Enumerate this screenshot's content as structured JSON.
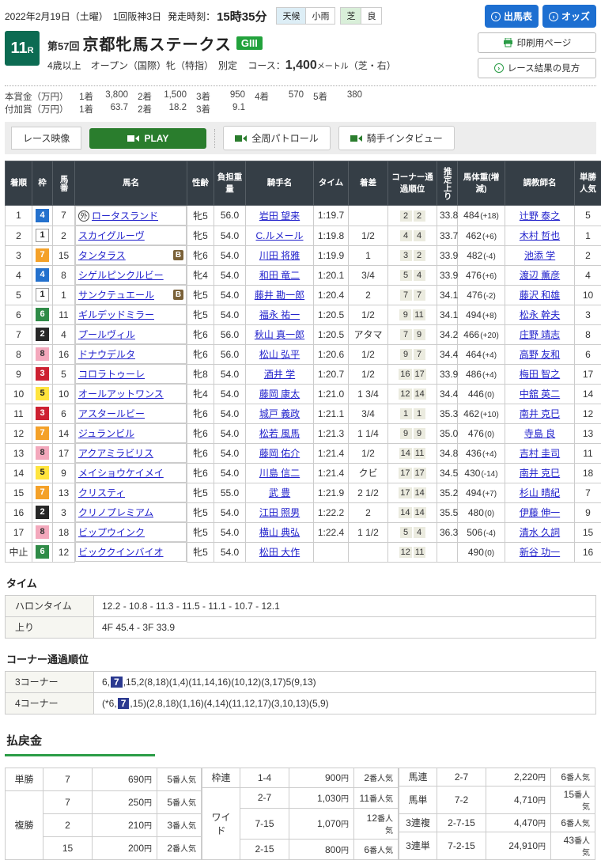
{
  "page": {
    "date_line": "2022年2月19日（土曜）　1回阪神3日",
    "start_label": "発走時刻：",
    "start_time": "15時35分",
    "weather_label": "天候",
    "weather_value": "小雨",
    "turf_label": "芝",
    "turf_value": "良",
    "buttons": {
      "entries": "出馬表",
      "odds": "オッズ",
      "print": "印刷用ページ",
      "guide": "レース結果の見方",
      "arrow_glyph": "›"
    }
  },
  "race": {
    "number": "11",
    "number_suffix": "R",
    "edition": "第57回",
    "title": "京都牝馬ステークス",
    "grade": "GIII",
    "conditions": "4歳以上　オープン（国際）牝（特指）　別定",
    "course_label": "コース：",
    "distance": "1,400",
    "distance_unit": "メートル",
    "course_note": "（芝・右）"
  },
  "prizes": {
    "main_label": "本賞金（万円）",
    "main": [
      {
        "rank": "1着",
        "amount": "3,800"
      },
      {
        "rank": "2着",
        "amount": "1,500"
      },
      {
        "rank": "3着",
        "amount": "950"
      },
      {
        "rank": "4着",
        "amount": "570"
      },
      {
        "rank": "5着",
        "amount": "380"
      }
    ],
    "additional_label": "付加賞（万円）",
    "additional": [
      {
        "rank": "1着",
        "amount": "63.7"
      },
      {
        "rank": "2着",
        "amount": "18.2"
      },
      {
        "rank": "3着",
        "amount": "9.1"
      }
    ]
  },
  "video": {
    "label": "レース映像",
    "play": "PLAY",
    "patrol": "全周パトロール",
    "interview": "騎手インタビュー"
  },
  "results": {
    "headers": {
      "pos": "着順",
      "waku": "枠",
      "num": "馬番",
      "name": "馬名",
      "sexage": "性齢",
      "weight": "負担重量",
      "jockey": "騎手名",
      "time": "タイム",
      "margin": "着差",
      "corner": "コーナー通過順位",
      "last3f": "推定上り",
      "hweight": "馬体重(増減)",
      "trainer": "調教師名",
      "pop": "単勝人気"
    },
    "rows": [
      {
        "pos": "1",
        "waku": "4",
        "num": "7",
        "mark": "外",
        "b": false,
        "name": "ロータスランド",
        "sexage": "牝5",
        "weight": "56.0",
        "jockey": "岩田 望来",
        "time": "1:19.7",
        "margin": "",
        "corner": [
          "2",
          "2"
        ],
        "last3f": "33.8",
        "hw": "484",
        "hwd": "(+18)",
        "trainer": "辻野 泰之",
        "pop": "5"
      },
      {
        "pos": "2",
        "waku": "1",
        "num": "2",
        "mark": "",
        "b": false,
        "name": "スカイグルーヴ",
        "sexage": "牝5",
        "weight": "54.0",
        "jockey": "C.ルメール",
        "time": "1:19.8",
        "margin": "1/2",
        "corner": [
          "4",
          "4"
        ],
        "last3f": "33.7",
        "hw": "462",
        "hwd": "(+6)",
        "trainer": "木村 哲也",
        "pop": "1"
      },
      {
        "pos": "3",
        "waku": "7",
        "num": "15",
        "mark": "",
        "b": true,
        "name": "タンタラス",
        "sexage": "牝6",
        "weight": "54.0",
        "jockey": "川田 将雅",
        "time": "1:19.9",
        "margin": "1",
        "corner": [
          "3",
          "2"
        ],
        "last3f": "33.9",
        "hw": "482",
        "hwd": "(-4)",
        "trainer": "池添 学",
        "pop": "2"
      },
      {
        "pos": "4",
        "waku": "4",
        "num": "8",
        "mark": "",
        "b": false,
        "name": "シゲルピンクルビー",
        "sexage": "牝4",
        "weight": "54.0",
        "jockey": "和田 竜二",
        "time": "1:20.1",
        "margin": "3/4",
        "corner": [
          "5",
          "4"
        ],
        "last3f": "33.9",
        "hw": "476",
        "hwd": "(+6)",
        "trainer": "渡辺 薫彦",
        "pop": "4"
      },
      {
        "pos": "5",
        "waku": "1",
        "num": "1",
        "mark": "",
        "b": true,
        "name": "サンクテュエール",
        "sexage": "牝5",
        "weight": "54.0",
        "jockey": "藤井 勘一郎",
        "time": "1:20.4",
        "margin": "2",
        "corner": [
          "7",
          "7"
        ],
        "last3f": "34.1",
        "hw": "476",
        "hwd": "(-2)",
        "trainer": "藤沢 和雄",
        "pop": "10"
      },
      {
        "pos": "6",
        "waku": "6",
        "num": "11",
        "mark": "",
        "b": false,
        "name": "ギルデッドミラー",
        "sexage": "牝5",
        "weight": "54.0",
        "jockey": "福永 祐一",
        "time": "1:20.5",
        "margin": "1/2",
        "corner": [
          "9",
          "11"
        ],
        "last3f": "34.1",
        "hw": "494",
        "hwd": "(+8)",
        "trainer": "松永 幹夫",
        "pop": "3"
      },
      {
        "pos": "7",
        "waku": "2",
        "num": "4",
        "mark": "",
        "b": false,
        "name": "プールヴィル",
        "sexage": "牝6",
        "weight": "56.0",
        "jockey": "秋山 真一郎",
        "time": "1:20.5",
        "margin": "アタマ",
        "corner": [
          "7",
          "9"
        ],
        "last3f": "34.2",
        "hw": "466",
        "hwd": "(+20)",
        "trainer": "庄野 靖志",
        "pop": "8"
      },
      {
        "pos": "8",
        "waku": "8",
        "num": "16",
        "mark": "",
        "b": false,
        "name": "ドナウデルタ",
        "sexage": "牝6",
        "weight": "56.0",
        "jockey": "松山 弘平",
        "time": "1:20.6",
        "margin": "1/2",
        "corner": [
          "9",
          "7"
        ],
        "last3f": "34.4",
        "hw": "464",
        "hwd": "(+4)",
        "trainer": "高野 友和",
        "pop": "6"
      },
      {
        "pos": "9",
        "waku": "3",
        "num": "5",
        "mark": "",
        "b": false,
        "name": "コロラトゥーレ",
        "sexage": "牝8",
        "weight": "54.0",
        "jockey": "酒井 学",
        "time": "1:20.7",
        "margin": "1/2",
        "corner": [
          "16",
          "17"
        ],
        "last3f": "33.9",
        "hw": "486",
        "hwd": "(+4)",
        "trainer": "梅田 智之",
        "pop": "17"
      },
      {
        "pos": "10",
        "waku": "5",
        "num": "10",
        "mark": "",
        "b": false,
        "name": "オールアットワンス",
        "sexage": "牝4",
        "weight": "54.0",
        "jockey": "藤岡 康太",
        "time": "1:21.0",
        "margin": "1 3/4",
        "corner": [
          "12",
          "14"
        ],
        "last3f": "34.4",
        "hw": "446",
        "hwd": "(0)",
        "trainer": "中舘 英二",
        "pop": "14"
      },
      {
        "pos": "11",
        "waku": "3",
        "num": "6",
        "mark": "",
        "b": false,
        "name": "アスタールビー",
        "sexage": "牝6",
        "weight": "54.0",
        "jockey": "城戸 義政",
        "time": "1:21.1",
        "margin": "3/4",
        "corner": [
          "1",
          "1"
        ],
        "last3f": "35.3",
        "hw": "462",
        "hwd": "(+10)",
        "trainer": "南井 克巳",
        "pop": "12"
      },
      {
        "pos": "12",
        "waku": "7",
        "num": "14",
        "mark": "",
        "b": false,
        "name": "ジュランビル",
        "sexage": "牝6",
        "weight": "54.0",
        "jockey": "松若 風馬",
        "time": "1:21.3",
        "margin": "1 1/4",
        "corner": [
          "9",
          "9"
        ],
        "last3f": "35.0",
        "hw": "476",
        "hwd": "(0)",
        "trainer": "寺島 良",
        "pop": "13"
      },
      {
        "pos": "13",
        "waku": "8",
        "num": "17",
        "mark": "",
        "b": false,
        "name": "アクアミラビリス",
        "sexage": "牝6",
        "weight": "54.0",
        "jockey": "藤岡 佑介",
        "time": "1:21.4",
        "margin": "1/2",
        "corner": [
          "14",
          "11"
        ],
        "last3f": "34.8",
        "hw": "436",
        "hwd": "(+4)",
        "trainer": "吉村 圭司",
        "pop": "11"
      },
      {
        "pos": "14",
        "waku": "5",
        "num": "9",
        "mark": "",
        "b": false,
        "name": "メイショウケイメイ",
        "sexage": "牝6",
        "weight": "54.0",
        "jockey": "川島 信二",
        "time": "1:21.4",
        "margin": "クビ",
        "corner": [
          "17",
          "17"
        ],
        "last3f": "34.5",
        "hw": "430",
        "hwd": "(-14)",
        "trainer": "南井 克巳",
        "pop": "18"
      },
      {
        "pos": "15",
        "waku": "7",
        "num": "13",
        "mark": "",
        "b": false,
        "name": "クリスティ",
        "sexage": "牝5",
        "weight": "55.0",
        "jockey": "武 豊",
        "time": "1:21.9",
        "margin": "2 1/2",
        "corner": [
          "17",
          "14"
        ],
        "last3f": "35.2",
        "hw": "494",
        "hwd": "(+7)",
        "trainer": "杉山 晴紀",
        "pop": "7"
      },
      {
        "pos": "16",
        "waku": "2",
        "num": "3",
        "mark": "",
        "b": false,
        "name": "クリノプレミアム",
        "sexage": "牝5",
        "weight": "54.0",
        "jockey": "江田 照男",
        "time": "1:22.2",
        "margin": "2",
        "corner": [
          "14",
          "14"
        ],
        "last3f": "35.5",
        "hw": "480",
        "hwd": "(0)",
        "trainer": "伊藤 伸一",
        "pop": "9"
      },
      {
        "pos": "17",
        "waku": "8",
        "num": "18",
        "mark": "",
        "b": false,
        "name": "ビップウインク",
        "sexage": "牝5",
        "weight": "54.0",
        "jockey": "横山 典弘",
        "time": "1:22.4",
        "margin": "1 1/2",
        "corner": [
          "5",
          "4"
        ],
        "last3f": "36.3",
        "hw": "506",
        "hwd": "(-4)",
        "trainer": "清水 久詞",
        "pop": "15"
      },
      {
        "pos": "中止",
        "waku": "6",
        "num": "12",
        "mark": "",
        "b": false,
        "name": "ビッククインバイオ",
        "sexage": "牝5",
        "weight": "54.0",
        "jockey": "松田 大作",
        "time": "",
        "margin": "",
        "corner": [
          "12",
          "11"
        ],
        "last3f": "",
        "hw": "490",
        "hwd": "(0)",
        "trainer": "新谷 功一",
        "pop": "16"
      }
    ]
  },
  "time_section": {
    "heading": "タイム",
    "rows": [
      {
        "label": "ハロンタイム",
        "value": "12.2 - 10.8 - 11.3 - 11.5 - 11.1 - 10.7 - 12.1"
      },
      {
        "label": "上り",
        "value": "4F 45.4 - 3F 33.9"
      }
    ]
  },
  "corner_section": {
    "heading": "コーナー通過順位",
    "rows": [
      {
        "label": "3コーナー",
        "pre": "6,",
        "mark": "7",
        "post": ",15,2(8,18)(1,4)(11,14,16)(10,12)(3,17)5(9,13)"
      },
      {
        "label": "4コーナー",
        "pre": "(*6,",
        "mark": "7",
        "post": ",15)(2,8,18)(1,16)(4,14)(11,12,17)(3,10,13)(5,9)"
      }
    ]
  },
  "payout": {
    "heading": "払戻金",
    "yen_suffix": "円",
    "pop_suffix": "番人気",
    "groups": [
      {
        "rows": [
          {
            "type": "単勝",
            "span": 1,
            "cells": [
              {
                "combo": "7",
                "amount": "690",
                "pop": "5"
              }
            ]
          },
          {
            "type": "複勝",
            "span": 3,
            "cells": [
              {
                "combo": "7",
                "amount": "250",
                "pop": "5"
              },
              {
                "combo": "2",
                "amount": "210",
                "pop": "3"
              },
              {
                "combo": "15",
                "amount": "200",
                "pop": "2"
              }
            ]
          }
        ]
      },
      {
        "rows": [
          {
            "type": "枠連",
            "span": 1,
            "cells": [
              {
                "combo": "1-4",
                "amount": "900",
                "pop": "2"
              }
            ]
          },
          {
            "type": "ワイド",
            "span": 3,
            "cells": [
              {
                "combo": "2-7",
                "amount": "1,030",
                "pop": "11"
              },
              {
                "combo": "7-15",
                "amount": "1,070",
                "pop": "12"
              },
              {
                "combo": "2-15",
                "amount": "800",
                "pop": "6"
              }
            ]
          }
        ]
      },
      {
        "rows": [
          {
            "type": "馬連",
            "span": 1,
            "cells": [
              {
                "combo": "2-7",
                "amount": "2,220",
                "pop": "6"
              }
            ]
          },
          {
            "type": "馬単",
            "span": 1,
            "cells": [
              {
                "combo": "7-2",
                "amount": "4,710",
                "pop": "15"
              }
            ]
          },
          {
            "type": "3連複",
            "span": 1,
            "cells": [
              {
                "combo": "2-7-15",
                "amount": "4,470",
                "pop": "6"
              }
            ]
          },
          {
            "type": "3連単",
            "span": 1,
            "cells": [
              {
                "combo": "7-2-15",
                "amount": "24,910",
                "pop": "43"
              }
            ]
          }
        ]
      }
    ]
  }
}
